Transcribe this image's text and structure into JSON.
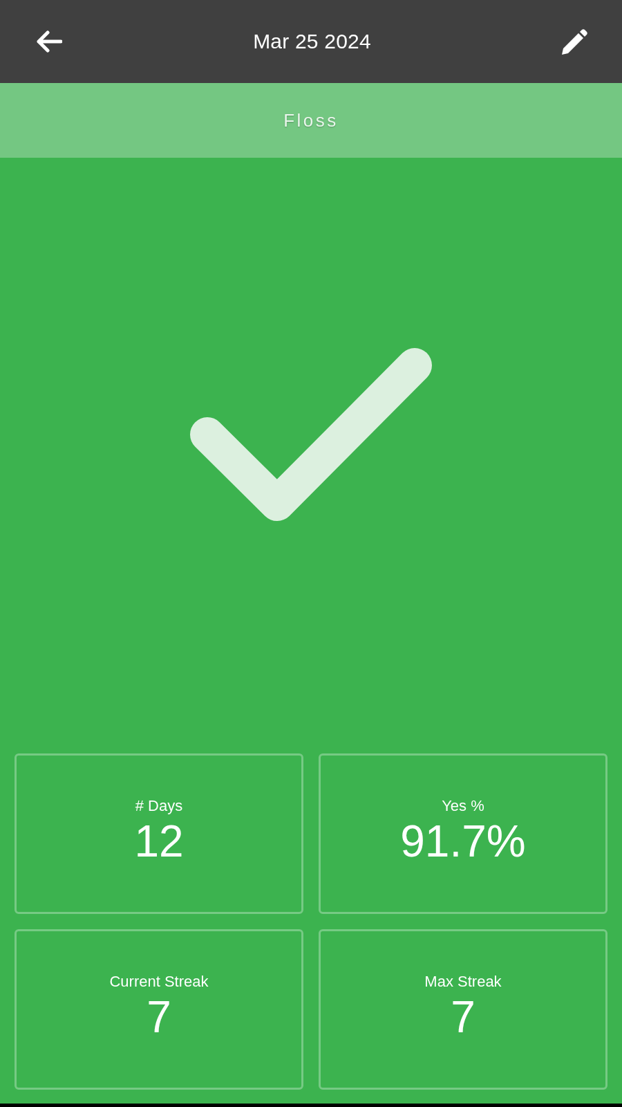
{
  "app_bar": {
    "title": "Mar 25 2024"
  },
  "habit": {
    "name": "Floss",
    "completed": true
  },
  "stats": [
    {
      "label": "# Days",
      "value": "12"
    },
    {
      "label": "Yes %",
      "value": "91.7%"
    },
    {
      "label": "Current Streak",
      "value": "7"
    },
    {
      "label": "Max Streak",
      "value": "7"
    }
  ]
}
